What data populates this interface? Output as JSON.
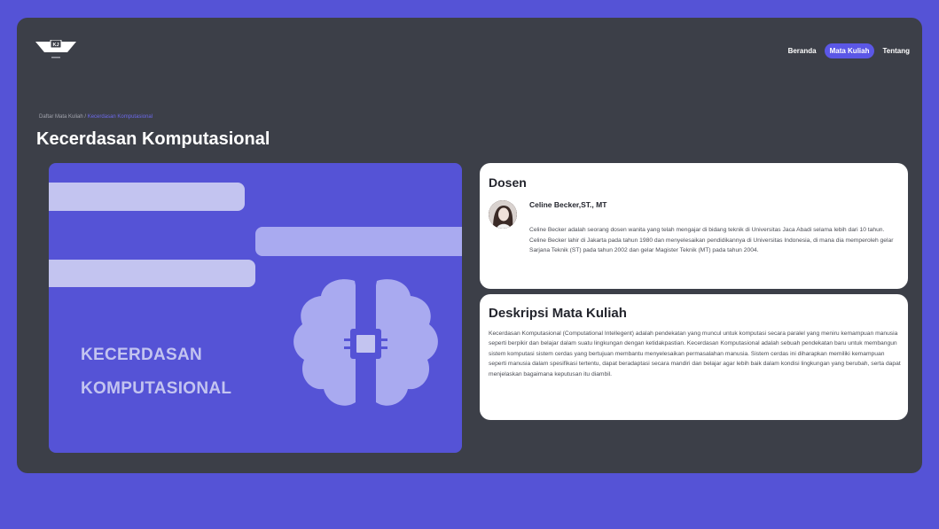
{
  "header": {
    "logo_text": "KJ",
    "nav": [
      {
        "label": "Beranda"
      },
      {
        "label": "Mata Kuliah",
        "active": true
      },
      {
        "label": "Tentang"
      }
    ]
  },
  "breadcrumb": {
    "parent": "Daftar Mata Kuliah",
    "separator": "/",
    "current": "Kecerdasan Komputasional"
  },
  "page_title": "Kecerdasan Komputasional",
  "hero": {
    "title": "KECERDASAN\nKOMPUTASIONAL",
    "icon": "brain-chip-icon"
  },
  "dosen": {
    "heading": "Dosen",
    "name": "Celine Becker,ST., MT",
    "bio": "Celine Becker adalah seorang dosen wanita yang telah mengajar di bidang teknik di Universitas Jaca Abadi selama lebih dari 10 tahun. Celine Becker lahir di Jakarta pada tahun 1980 dan menyelesaikan pendidikannya di Universitas Indonesia, di mana dia memperoleh gelar Sarjana Teknik (ST) pada tahun 2002 dan gelar Magister Teknik (MT) pada tahun 2004."
  },
  "deskripsi": {
    "heading": "Deskripsi Mata Kuliah",
    "text": "Kecerdasan Komputasional (Computational Intellegent) adalah pendekatan yang muncul untuk komputasi secara paralel yang meniru kemampuan manusia seperti berpikir dan belajar dalam suatu lingkungan dengan ketidakpastian. Kecerdasan Komputasional adalah sebuah pendekatan baru untuk membangun sistem komputasi sistem cerdas yang bertujuan membantu menyelesaikan permasalahan manusia. Sistem cerdas ini diharapkan memiliki kemampuan seperti manusia dalam spesifikasi tertentu, dapat beradaptasi secara mandiri dan belajar agar lebih baik dalam kondisi lingkungan yang berubah, serta dapat menjelaskan bagaimana keputusan itu diambil."
  },
  "colors": {
    "page_bg": "#5553d6",
    "frame_bg": "#3c3f48",
    "accent": "#5b57e6",
    "card_bg": "#ffffff"
  }
}
